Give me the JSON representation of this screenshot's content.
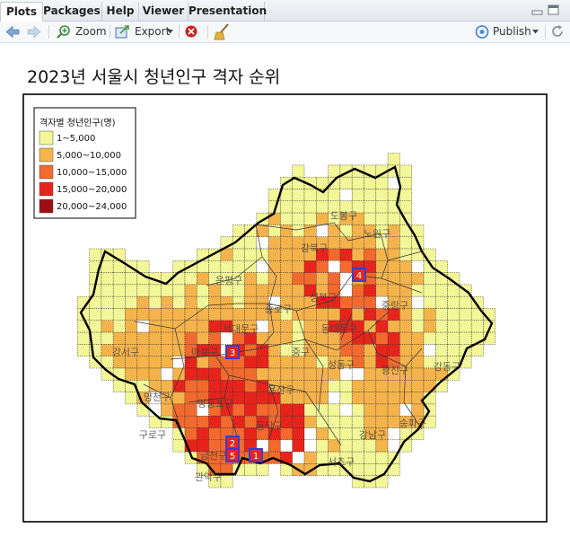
{
  "tabs": [
    {
      "label": "Plots",
      "active": true
    },
    {
      "label": "Packages",
      "active": false
    },
    {
      "label": "Help",
      "active": false
    },
    {
      "label": "Viewer",
      "active": false
    },
    {
      "label": "Presentation",
      "active": false
    }
  ],
  "toolbar": {
    "zoom_label": "Zoom",
    "export_label": "Export",
    "publish_label": "Publish"
  },
  "plot": {
    "title": "2023년 서울시 청년인구 격자 순위",
    "legend_title": "격자별 청년인구(명)",
    "legend_items": [
      {
        "label": "1~5,000",
        "color": "#f3f797"
      },
      {
        "label": "5,000~10,000",
        "color": "#f5b34c"
      },
      {
        "label": "10,000~15,000",
        "color": "#f26a2e"
      },
      {
        "label": "15,000~20,000",
        "color": "#e6241c"
      },
      {
        "label": "20,000~24,000",
        "color": "#9e0f14"
      }
    ],
    "rank_labels": [
      "1",
      "2",
      "3",
      "4",
      "5"
    ],
    "district_labels": [
      "도봉구",
      "노원구",
      "강북구",
      "은평구",
      "성북구",
      "종로구",
      "중랑구",
      "서대문구",
      "동대문구",
      "마포구",
      "중구",
      "강서구",
      "성동구",
      "광진구",
      "용산구",
      "강동구",
      "양천구",
      "영등포구",
      "동작구",
      "송파구",
      "강남구",
      "구로구",
      "관악구",
      "서초구",
      "금천구"
    ]
  },
  "colors": {
    "accent_blue": "#3a6fc4",
    "rank_box": "#3d3dc9"
  }
}
